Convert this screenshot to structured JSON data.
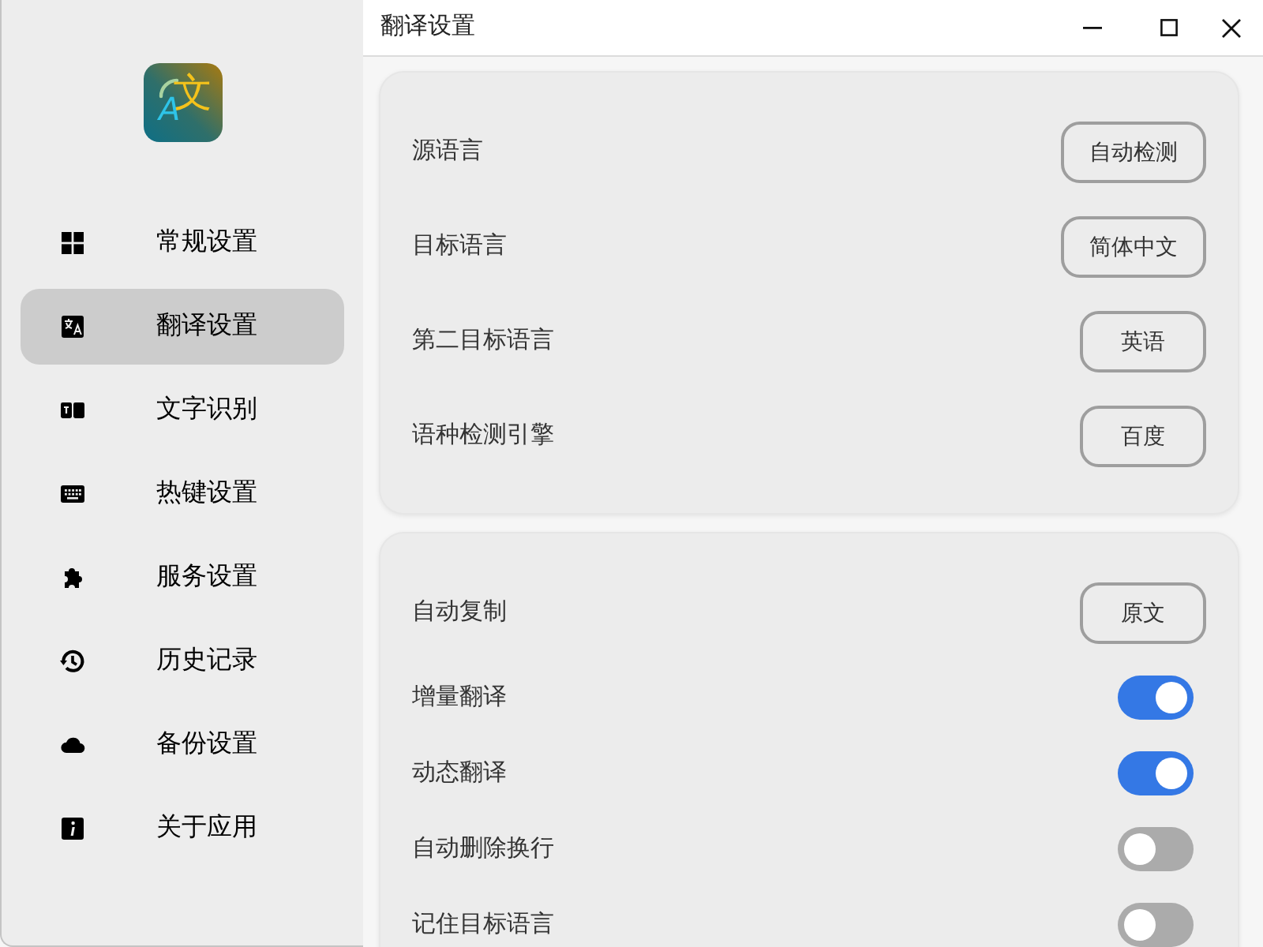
{
  "sidebar": {
    "logo": {
      "accent": "A",
      "mark": "文"
    },
    "items": [
      {
        "label": "常规设置",
        "selected": false
      },
      {
        "label": "翻译设置",
        "selected": true
      },
      {
        "label": "文字识别",
        "selected": false
      },
      {
        "label": "热键设置",
        "selected": false
      },
      {
        "label": "服务设置",
        "selected": false
      },
      {
        "label": "历史记录",
        "selected": false
      },
      {
        "label": "备份设置",
        "selected": false
      },
      {
        "label": "关于应用",
        "selected": false
      }
    ]
  },
  "window": {
    "title": "翻译设置"
  },
  "sections": [
    {
      "rows": [
        {
          "kind": "select",
          "label": "源语言",
          "value": "自动检测"
        },
        {
          "kind": "select",
          "label": "目标语言",
          "value": "简体中文"
        },
        {
          "kind": "select",
          "label": "第二目标语言",
          "value": "英语"
        },
        {
          "kind": "select",
          "label": "语种检测引擎",
          "value": "百度"
        }
      ]
    },
    {
      "rows": [
        {
          "kind": "select",
          "label": "自动复制",
          "value": "原文"
        },
        {
          "kind": "toggle",
          "label": "增量翻译",
          "on": true
        },
        {
          "kind": "toggle",
          "label": "动态翻译",
          "on": true
        },
        {
          "kind": "toggle",
          "label": "自动删除换行",
          "on": false
        },
        {
          "kind": "toggle",
          "label": "记住目标语言",
          "on": false
        }
      ]
    }
  ]
}
